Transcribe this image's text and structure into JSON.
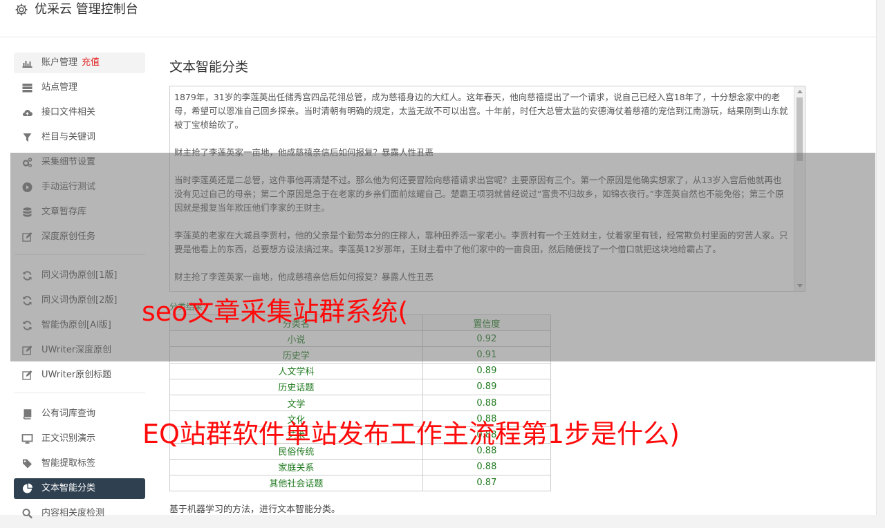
{
  "app": {
    "title": "优采云 管理控制台",
    "icon": "gear-icon"
  },
  "sidebar": {
    "group1": [
      {
        "label": "账户管理",
        "badge": "充值",
        "icon": "bar-chart-icon",
        "state": "hover"
      },
      {
        "label": "站点管理",
        "icon": "server-icon"
      },
      {
        "label": "接口文件相关",
        "icon": "cloud-upload-icon"
      },
      {
        "label": "栏目与关键词",
        "icon": "filter-icon"
      },
      {
        "label": "采集细节设置",
        "icon": "cogs-icon"
      },
      {
        "label": "手动运行测试",
        "icon": "play-circle-icon"
      },
      {
        "label": "文章暂存库",
        "icon": "database-icon"
      },
      {
        "label": "深度原创任务",
        "icon": "edit-icon"
      }
    ],
    "group2": [
      {
        "label": "同义词伪原创[1版]",
        "icon": "refresh-icon"
      },
      {
        "label": "同义词伪原创[2版]",
        "icon": "refresh-icon"
      },
      {
        "label": "智能伪原创[AI版]",
        "icon": "refresh-icon"
      },
      {
        "label": "UWriter深度原创",
        "icon": "edit-icon"
      },
      {
        "label": "UWriter原创标题",
        "icon": "edit-icon"
      }
    ],
    "group3": [
      {
        "label": "公有词库查询",
        "icon": "book-icon"
      },
      {
        "label": "正文识别演示",
        "icon": "monitor-icon"
      },
      {
        "label": "智能提取标签",
        "icon": "tag-icon"
      },
      {
        "label": "文本智能分类",
        "icon": "pie-chart-icon",
        "state": "active"
      },
      {
        "label": "内容相关度检测",
        "icon": "search-icon"
      }
    ]
  },
  "main": {
    "title": "文本智能分类",
    "text_paragraphs": [
      "1879年，31岁的李莲英出任储秀宫四品花翎总管，成为慈禧身边的大红人。这年春天，他向慈禧提出了一个请求，说自己已经入宫18年了，十分想念家中的老母，希望可以恩准自己回乡探亲。当时清朝有明确的规定，太监无故不可以出宫。十年前，时任大总管太监的安德海仗着慈禧的宠信到江南游玩，结果刚到山东就被丁宝桢给砍了。",
      "财主抢了李莲英家一亩地，他成慈禧亲信后如何报复？暴露人性丑恶",
      "当时李莲英还是二总管，这件事他再清楚不过。那么他为何还要冒险向慈禧请求出宫呢？主要原因有三个。第一个原因是他确实想家了，从13岁入宫后他就再也没有见过自己的母亲；第二个原因是急于在老家的乡亲们面前炫耀自己。楚霸王项羽就曾经说过“富贵不归故乡，如锦衣夜行。”李莲英自然也不能免俗；第三个原因就是报复当年欺压他们李家的王财主。",
      "李莲英的老家在大城县李贾村，他的父亲是个勤劳本分的庄稼人，靠种田养活一家老小。李贾村有一个王姓财主，仗着家里有钱，经常欺负村里面的穷苦人家。只要是他看上的东西，总要想方设法搞过来。李莲英12岁那年，王财主看中了他们家中的一亩良田，然后随便找了一个借口就把这块地给霸占了。",
      "财主抢了李莲英家一亩地，他成慈禧亲信后如何报复？暴露人性丑恶"
    ],
    "result_label": "分类结果：",
    "table": {
      "headers": [
        "分类名",
        "置信度"
      ],
      "rows": [
        [
          "小说",
          "0.92"
        ],
        [
          "历史学",
          "0.91"
        ],
        [
          "人文学科",
          "0.89"
        ],
        [
          "历史话题",
          "0.89"
        ],
        [
          "文学",
          "0.88"
        ],
        [
          "文化",
          "0.88"
        ],
        [
          "艺术",
          "0.88"
        ],
        [
          "民俗传统",
          "0.88"
        ],
        [
          "家庭关系",
          "0.88"
        ],
        [
          "其他社会话题",
          "0.87"
        ]
      ]
    },
    "footer_note": "基于机器学习的方法，进行文本智能分类。"
  },
  "overlay_captions": [
    "seo文章采集站群系统(",
    "EQ站群软件单站发布工作主流程第1步是什么)"
  ]
}
